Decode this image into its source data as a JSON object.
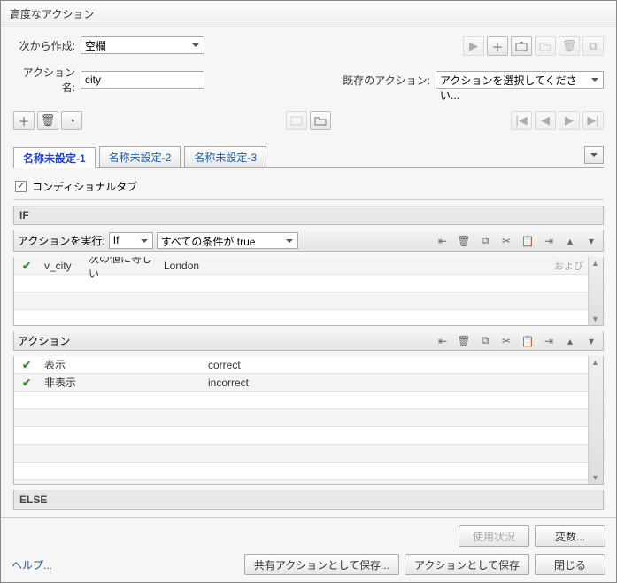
{
  "title": "高度なアクション",
  "createFrom": {
    "label": "次から作成:",
    "value": "空欄"
  },
  "actionName": {
    "label": "アクション名:",
    "value": "city"
  },
  "existingAction": {
    "label": "既存のアクション:",
    "value": "アクションを選択してください..."
  },
  "tabs": [
    "名称未設定-1",
    "名称未設定-2",
    "名称未設定-3"
  ],
  "conditionalTab": {
    "label": "コンディショナルタブ",
    "checked": true
  },
  "ifLabel": "IF",
  "execAction": {
    "label": "アクションを実行:",
    "value": "If"
  },
  "condMode": "すべての条件が true",
  "conditions": [
    {
      "field": "v_city",
      "op": "次の値に等しい",
      "value": "London"
    }
  ],
  "andOr": "および",
  "actionHeader": "アクション",
  "actions": [
    {
      "action": "表示",
      "target": "correct"
    },
    {
      "action": "非表示",
      "target": "incorrect"
    }
  ],
  "elseLabel": "ELSE",
  "buttons": {
    "usage": "使用状況",
    "variables": "変数...",
    "saveShared": "共有アクションとして保存...",
    "saveAction": "アクションとして保存",
    "close": "閉じる"
  },
  "help": "ヘルプ..."
}
